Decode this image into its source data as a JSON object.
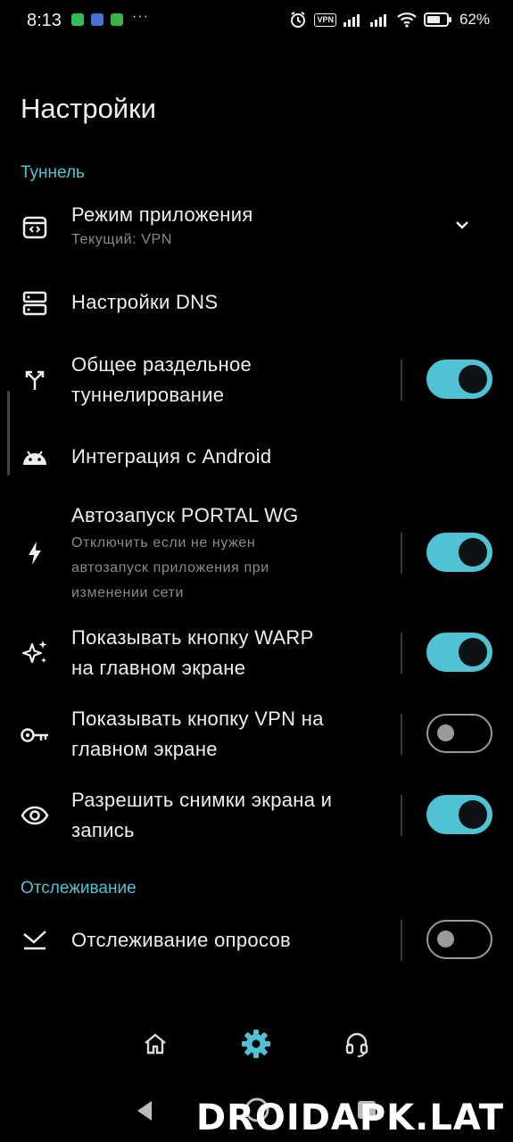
{
  "status_bar": {
    "time": "8:13",
    "vpn_badge": "VPN",
    "battery_percent": "62%"
  },
  "header": {
    "title": "Настройки"
  },
  "sections": {
    "tunnel": "Туннель",
    "tracking": "Отслеживание"
  },
  "settings": {
    "app_mode": {
      "title": "Режим приложения",
      "subtitle": "Текущий: VPN",
      "icon": "app-mode-icon"
    },
    "dns": {
      "title": "Настройки DNS",
      "icon": "dns-server-icon"
    },
    "split_tunnel": {
      "title_line1": "Общее раздельное",
      "title_line2": "туннелирование",
      "enabled": true,
      "icon": "split-arrows-icon"
    },
    "android_integration": {
      "title": "Интеграция с Android",
      "icon": "android-icon"
    },
    "autostart": {
      "title": "Автозапуск PORTAL WG",
      "subtitle_line1": "Отключить если не нужен",
      "subtitle_line2": "автозапуск приложения при",
      "subtitle_line3": "изменении сети",
      "enabled": true,
      "icon": "lightning-icon"
    },
    "warp_button": {
      "title_line1": "Показывать кнопку WARP",
      "title_line2": "на главном экране",
      "enabled": true,
      "icon": "sparkles-icon"
    },
    "vpn_button": {
      "title_line1": "Показывать кнопку VPN на",
      "title_line2": "главном экране",
      "enabled": false,
      "icon": "key-icon"
    },
    "screenshots": {
      "title_line1": "Разрешить снимки экрана и",
      "title_line2": "запись",
      "enabled": true,
      "icon": "eye-icon"
    },
    "polling": {
      "title": "Отслеживание опросов",
      "enabled": false,
      "icon": "polling-icon"
    }
  },
  "bottom_nav": {
    "items": [
      "home-icon",
      "settings-gear-icon",
      "support-headset-icon"
    ],
    "active": "settings-gear-icon"
  },
  "watermark": "DROIDAPK.LAT",
  "colors": {
    "accent": "#4fc3d4",
    "background": "#000000",
    "text": "#eeeeee",
    "subtext": "#8a8a8a"
  }
}
